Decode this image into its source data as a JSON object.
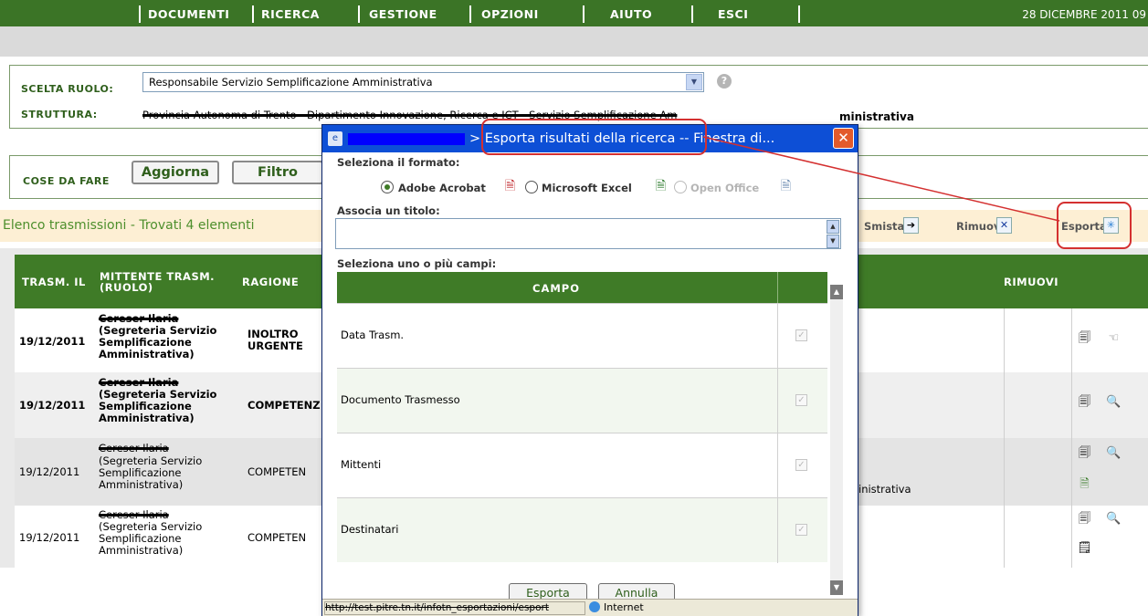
{
  "menu": {
    "items": [
      "DOCUMENTI",
      "RICERCA",
      "GESTIONE",
      "OPZIONI",
      "AIUTO",
      "ESCI"
    ],
    "date": "28 DICEMBRE 2011 09"
  },
  "role": {
    "ruolo_label": "SCELTA RUOLO:",
    "ruolo_value": "Responsabile Servizio Semplificazione Amministrativa",
    "struttura_label": "STRUTTURA:",
    "struttura_value": "Provincia Autonoma di Trento - Dipartimento Innovazione, Ricerca e ICT - Servizio Semplificazione Am",
    "struttura_tail": "ministrativa",
    "help_icon": "help-icon"
  },
  "todo": {
    "label": "COSE DA FARE",
    "aggiorna": "Aggiorna",
    "filtro": "Filtro"
  },
  "list": {
    "title": "Elenco trasmissioni - Trovati 4 elementi",
    "actions": {
      "smista": "Smista",
      "rimuovi": "Rimuovi",
      "esporta": "Esporta"
    }
  },
  "table": {
    "headers": {
      "trasm_il": "TRASM. IL",
      "mittente_1": "MITTENTE TRASM.",
      "mittente_2": "(RUOLO)",
      "ragione": "RAGIONE",
      "rimuovi": "RIMUOVI"
    },
    "rows": [
      {
        "date": "19/12/2011",
        "sender": "Cereser Ilaria",
        "role_1": "(Segreteria Servizio",
        "role_2": "Semplificazione",
        "role_3": "Amministrativa)",
        "reason_1": "INOLTRO",
        "reason_2": "URGENTE",
        "extra": ""
      },
      {
        "date": "19/12/2011",
        "sender": "Cereser Ilaria",
        "role_1": "(Segreteria Servizio",
        "role_2": "Semplificazione",
        "role_3": "Amministrativa)",
        "reason_1": "COMPETENZ",
        "reason_2": "",
        "extra": ""
      },
      {
        "date": "19/12/2011",
        "sender": "Cereser Ilaria",
        "role_1": "(Segreteria Servizio",
        "role_2": "Semplificazione",
        "role_3": "Amministrativa)",
        "reason_1": "COMPETEN",
        "reason_2": "",
        "extra": "inistrativa"
      },
      {
        "date": "19/12/2011",
        "sender": "Cereser Ilaria",
        "role_1": "(Segreteria Servizio",
        "role_2": "Semplificazione",
        "role_3": "Amministrativa)",
        "reason_1": "COMPETEN",
        "reason_2": "",
        "extra": ""
      }
    ]
  },
  "dialog": {
    "title": "> Esporta risultati della ricerca -- Finestra di...",
    "formato_label": "Seleziona il formato:",
    "formats": {
      "acrobat": "Adobe Acrobat",
      "excel": "Microsoft Excel",
      "openoffice": "Open Office"
    },
    "titolo_label": "Associa un titolo:",
    "titolo_value": "",
    "campi_label": "Seleziona uno o più campi:",
    "campo_header": "CAMPO",
    "campi": [
      "Data Trasm.",
      "Documento Trasmesso",
      "Mittenti",
      "Destinatari"
    ],
    "esporta": "Esporta",
    "annulla": "Annulla",
    "status_url": "http://test.pitre.tn.it/infotn_esportazioni/esport",
    "status_zone": "Internet"
  },
  "colors": {
    "menu_green": "#3b7426",
    "header_green": "#3f7b27",
    "accent_red": "#d43030",
    "dialog_blue": "#0d4fd6"
  }
}
